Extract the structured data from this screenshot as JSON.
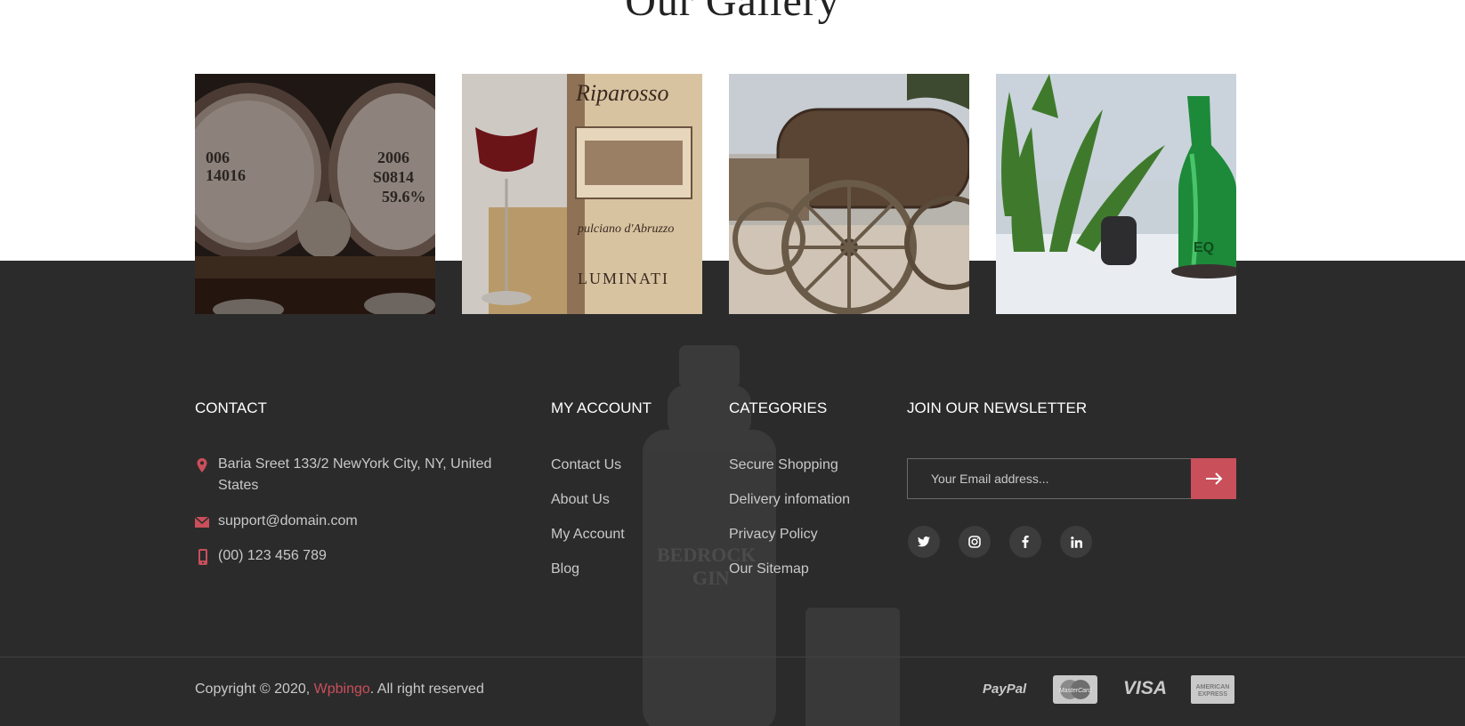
{
  "gallery": {
    "title": "Our Gallery",
    "images": [
      {
        "name": "whiskey-barrels-photo"
      },
      {
        "name": "wine-bottle-glass-photo"
      },
      {
        "name": "water-cart-photo"
      },
      {
        "name": "green-bottle-plant-photo"
      }
    ]
  },
  "contact": {
    "title": "CONTACT",
    "address_line1": "Baria Sreet 133/2 NewYork City, NY, United",
    "address_line2": "States",
    "email": "support@domain.com",
    "phone": "(00) 123 456 789"
  },
  "account": {
    "title": "MY ACCOUNT",
    "links": [
      "Contact Us",
      "About Us",
      "My Account",
      "Blog"
    ]
  },
  "categories": {
    "title": "CATEGORIES",
    "links": [
      "Secure Shopping",
      "Delivery infomation",
      "Privacy Policy",
      "Our Sitemap"
    ]
  },
  "newsletter": {
    "title": "JOIN OUR NEWSLETTER",
    "placeholder": "Your Email address...",
    "social": [
      "twitter-icon",
      "instagram-icon",
      "facebook-icon",
      "linkedin-icon"
    ]
  },
  "copyright": {
    "prefix": "Copyright © 2020, ",
    "brand": "Wpbingo",
    "suffix": ". All right reserved"
  },
  "payments": {
    "paypal": "PayPal",
    "mastercard": "MasterCard",
    "visa": "VISA",
    "amex_line1": "AMERICAN",
    "amex_line2": "EXPRESS"
  },
  "colors": {
    "footer_bg": "#2c2b2c",
    "accent": "#c94f5a",
    "text_muted": "#c9c9c9"
  }
}
